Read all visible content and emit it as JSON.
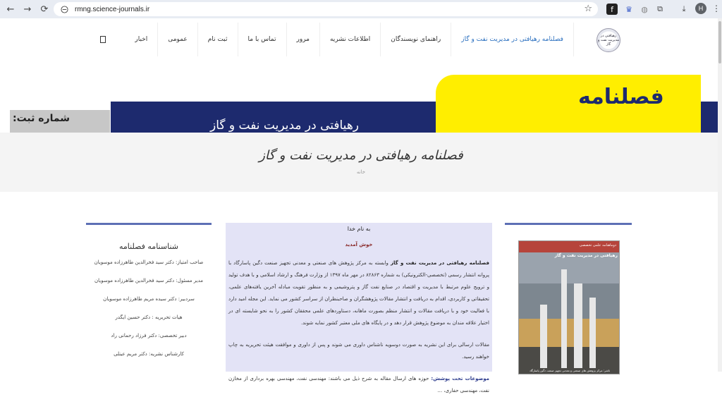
{
  "browser": {
    "url": "rmng.science-journals.ir",
    "profile_initial": "H"
  },
  "header": {
    "logo_text": "رهیافتی در مدیریت نفت و گاز",
    "menu": [
      {
        "label": "فصلنامه رهیافتی در مدیریت نفت و گاز",
        "active": true
      },
      {
        "label": "راهنمای نویسندگان"
      },
      {
        "label": "اطلاعات نشریه"
      },
      {
        "label": "مرور"
      },
      {
        "label": "تماس با ما"
      },
      {
        "label": "ثبت نام"
      },
      {
        "label": "عمومی"
      },
      {
        "label": "اخبار"
      }
    ]
  },
  "banner": {
    "title": "فصلنامه",
    "subtitle": "رهیافتی در مدیریت نفت و گاز",
    "registration": "شماره ثبت:"
  },
  "page": {
    "title": "فصلنامه رهیافتی در مدیریت نفت و گاز",
    "breadcrumb": "خانه"
  },
  "identity": {
    "heading": "شناسنامه فصلنامه",
    "rows": [
      "صاحب امتیاز: دکتر سید فخرالدین طاهرزاده موسویان",
      "مدیر مسئول: دکتر سید فخرالدین طاهرزاده موسویان",
      "سردبیر: دکتر سیده مریم طاهرزاده موسویان",
      "هیات تحریریه : دکتر حسین ایگدر",
      "دبیر تخصصی: دکتر فرزاد رحمانی راد",
      "کارشناس نشریه: دکتر مریم عینلی"
    ]
  },
  "intro": {
    "bismillah": "به نام خدا",
    "welcome": "خوش آمدید",
    "p1_bold": "فصلنامه رهیافتی در مدیریت نفت و گاز",
    "p1": " وابسته به مرکز پژوهش های صنعتی و معدنی تجهیز صنعت دگین پاسارگاد با پروانه انتشار رسمی (تخصصی-الکترونیکی) به شماره ۸۲۸۶۳ در مهر ماه ۱۳۹۷ از وزارت فرهنگ و ارشاد اسلامی و با هدف تولید و ترویج علوم مرتبط با مدیریت و اقتصاد در صنایع نفت گاز و پتروشیمی و به منظور تقویت مبادله آخرین یافته‌های علمی، تحقیقاتی و کاربردی، اقدام به دریافت و انتشار مقالات پژوهشگران و صاحبنظران از سراسر کشور می نماید. این مجله امید دارد با فعالیت خود و با دریافت مقالات و انتشار منظم بصورت ماهانه، دستاوردهای علمی محققان کشور را به نحو شایسته ای در اختیار علاقه مندان به موضوع پژوهش قرار دهد و در پایگاه های ملی معتبر کشور نمایه شوند.",
    "p2": "مقالات ارسالی برای این نشریه به صورت دوسویه ناشناس داوری می شوند و پس از داوری و موافقت هیئت تحریریه به چاپ خواهند رسید.",
    "topics_label": "موضوعات تحت پوشش:",
    "topics": " حوزه های ارسال مقاله به شرح ذیل می باشند: مهندسی نفت، مهندسی بهره برداری از مخازن نفت، مهندسی حفاری، ..."
  },
  "cover": {
    "top_line": "دوماهنامه علمی تخصصی",
    "title": "رهیافتی در مدیریت نفت و گاز",
    "footer": "ناشر: مرکز پژوهش های صنعتی و معدنی تجهیز صنعت دگین پاسارگاد"
  }
}
